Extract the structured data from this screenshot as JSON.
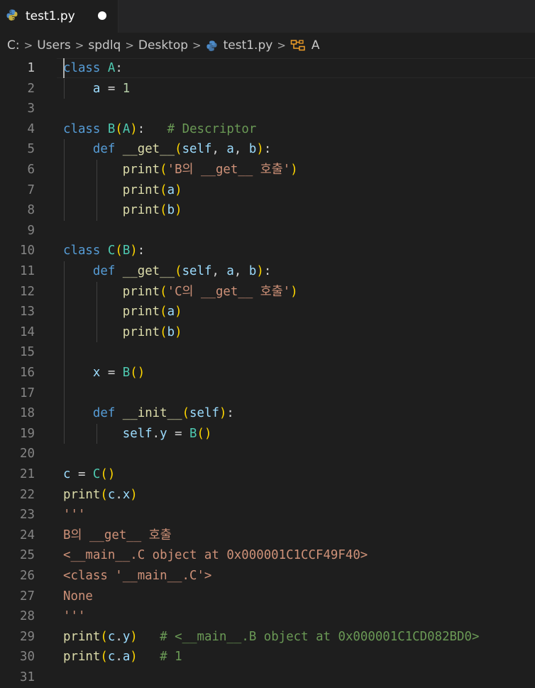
{
  "tab": {
    "filename": "test1.py",
    "icon": "python-icon",
    "modified_indicator": "dirty-dot"
  },
  "breadcrumb": [
    "C:",
    "Users",
    "spdlq",
    "Desktop",
    "test1.py",
    "A"
  ],
  "editor": {
    "active_line": 1,
    "lines": [
      {
        "n": "1",
        "t": [
          [
            "k",
            "class"
          ],
          [
            "p",
            " "
          ],
          [
            "c",
            "A"
          ],
          [
            "p",
            ":"
          ]
        ]
      },
      {
        "n": "2",
        "t": [
          [
            "p",
            "    "
          ],
          [
            "v",
            "a"
          ],
          [
            "p",
            " = "
          ],
          [
            "n",
            "1"
          ]
        ]
      },
      {
        "n": "3",
        "t": []
      },
      {
        "n": "4",
        "t": [
          [
            "k",
            "class"
          ],
          [
            "p",
            " "
          ],
          [
            "c",
            "B"
          ],
          [
            "b1",
            "("
          ],
          [
            "c",
            "A"
          ],
          [
            "b1",
            ")"
          ],
          [
            "p",
            ":   "
          ],
          [
            "cm",
            "# Descriptor"
          ]
        ]
      },
      {
        "n": "5",
        "t": [
          [
            "p",
            "    "
          ],
          [
            "k",
            "def"
          ],
          [
            "p",
            " "
          ],
          [
            "f",
            "__get__"
          ],
          [
            "b1",
            "("
          ],
          [
            "v",
            "self"
          ],
          [
            "p",
            ", "
          ],
          [
            "v",
            "a"
          ],
          [
            "p",
            ", "
          ],
          [
            "v",
            "b"
          ],
          [
            "b1",
            ")"
          ],
          [
            "p",
            ":"
          ]
        ]
      },
      {
        "n": "6",
        "t": [
          [
            "p",
            "        "
          ],
          [
            "f",
            "print"
          ],
          [
            "b1",
            "("
          ],
          [
            "s",
            "'B의 __get__ 호출'"
          ],
          [
            "b1",
            ")"
          ]
        ]
      },
      {
        "n": "7",
        "t": [
          [
            "p",
            "        "
          ],
          [
            "f",
            "print"
          ],
          [
            "b1",
            "("
          ],
          [
            "v",
            "a"
          ],
          [
            "b1",
            ")"
          ]
        ]
      },
      {
        "n": "8",
        "t": [
          [
            "p",
            "        "
          ],
          [
            "f",
            "print"
          ],
          [
            "b1",
            "("
          ],
          [
            "v",
            "b"
          ],
          [
            "b1",
            ")"
          ]
        ]
      },
      {
        "n": "9",
        "t": []
      },
      {
        "n": "10",
        "t": [
          [
            "k",
            "class"
          ],
          [
            "p",
            " "
          ],
          [
            "c",
            "C"
          ],
          [
            "b1",
            "("
          ],
          [
            "c",
            "B"
          ],
          [
            "b1",
            ")"
          ],
          [
            "p",
            ":"
          ]
        ]
      },
      {
        "n": "11",
        "t": [
          [
            "p",
            "    "
          ],
          [
            "k",
            "def"
          ],
          [
            "p",
            " "
          ],
          [
            "f",
            "__get__"
          ],
          [
            "b1",
            "("
          ],
          [
            "v",
            "self"
          ],
          [
            "p",
            ", "
          ],
          [
            "v",
            "a"
          ],
          [
            "p",
            ", "
          ],
          [
            "v",
            "b"
          ],
          [
            "b1",
            ")"
          ],
          [
            "p",
            ":"
          ]
        ]
      },
      {
        "n": "12",
        "t": [
          [
            "p",
            "        "
          ],
          [
            "f",
            "print"
          ],
          [
            "b1",
            "("
          ],
          [
            "s",
            "'C의 __get__ 호출'"
          ],
          [
            "b1",
            ")"
          ]
        ]
      },
      {
        "n": "13",
        "t": [
          [
            "p",
            "        "
          ],
          [
            "f",
            "print"
          ],
          [
            "b1",
            "("
          ],
          [
            "v",
            "a"
          ],
          [
            "b1",
            ")"
          ]
        ]
      },
      {
        "n": "14",
        "t": [
          [
            "p",
            "        "
          ],
          [
            "f",
            "print"
          ],
          [
            "b1",
            "("
          ],
          [
            "v",
            "b"
          ],
          [
            "b1",
            ")"
          ]
        ]
      },
      {
        "n": "15",
        "t": []
      },
      {
        "n": "16",
        "t": [
          [
            "p",
            "    "
          ],
          [
            "v",
            "x"
          ],
          [
            "p",
            " = "
          ],
          [
            "c",
            "B"
          ],
          [
            "b1",
            "()"
          ]
        ]
      },
      {
        "n": "17",
        "t": []
      },
      {
        "n": "18",
        "t": [
          [
            "p",
            "    "
          ],
          [
            "k",
            "def"
          ],
          [
            "p",
            " "
          ],
          [
            "f",
            "__init__"
          ],
          [
            "b1",
            "("
          ],
          [
            "v",
            "self"
          ],
          [
            "b1",
            ")"
          ],
          [
            "p",
            ":"
          ]
        ]
      },
      {
        "n": "19",
        "t": [
          [
            "p",
            "        "
          ],
          [
            "v",
            "self"
          ],
          [
            "p",
            "."
          ],
          [
            "v",
            "y"
          ],
          [
            "p",
            " = "
          ],
          [
            "c",
            "B"
          ],
          [
            "b1",
            "()"
          ]
        ]
      },
      {
        "n": "20",
        "t": []
      },
      {
        "n": "21",
        "t": [
          [
            "v",
            "c"
          ],
          [
            "p",
            " = "
          ],
          [
            "c",
            "C"
          ],
          [
            "b1",
            "()"
          ]
        ]
      },
      {
        "n": "22",
        "t": [
          [
            "f",
            "print"
          ],
          [
            "b1",
            "("
          ],
          [
            "v",
            "c"
          ],
          [
            "p",
            "."
          ],
          [
            "v",
            "x"
          ],
          [
            "b1",
            ")"
          ]
        ]
      },
      {
        "n": "23",
        "t": [
          [
            "s",
            "'''"
          ]
        ]
      },
      {
        "n": "24",
        "t": [
          [
            "s",
            "B의 __get__ 호출"
          ]
        ]
      },
      {
        "n": "25",
        "t": [
          [
            "s",
            "<__main__.C object at 0x000001C1CCF49F40>"
          ]
        ]
      },
      {
        "n": "26",
        "t": [
          [
            "s",
            "<class '__main__.C'>"
          ]
        ]
      },
      {
        "n": "27",
        "t": [
          [
            "s",
            "None"
          ]
        ]
      },
      {
        "n": "28",
        "t": [
          [
            "s",
            "'''"
          ]
        ]
      },
      {
        "n": "29",
        "t": [
          [
            "f",
            "print"
          ],
          [
            "b1",
            "("
          ],
          [
            "v",
            "c"
          ],
          [
            "p",
            "."
          ],
          [
            "v",
            "y"
          ],
          [
            "b1",
            ")"
          ],
          [
            "p",
            "   "
          ],
          [
            "cm",
            "# <__main__.B object at 0x000001C1CD082BD0>"
          ]
        ]
      },
      {
        "n": "30",
        "t": [
          [
            "f",
            "print"
          ],
          [
            "b1",
            "("
          ],
          [
            "v",
            "c"
          ],
          [
            "p",
            "."
          ],
          [
            "v",
            "a"
          ],
          [
            "b1",
            ")"
          ],
          [
            "p",
            "   "
          ],
          [
            "cm",
            "# 1"
          ]
        ]
      },
      {
        "n": "31",
        "t": []
      }
    ]
  }
}
